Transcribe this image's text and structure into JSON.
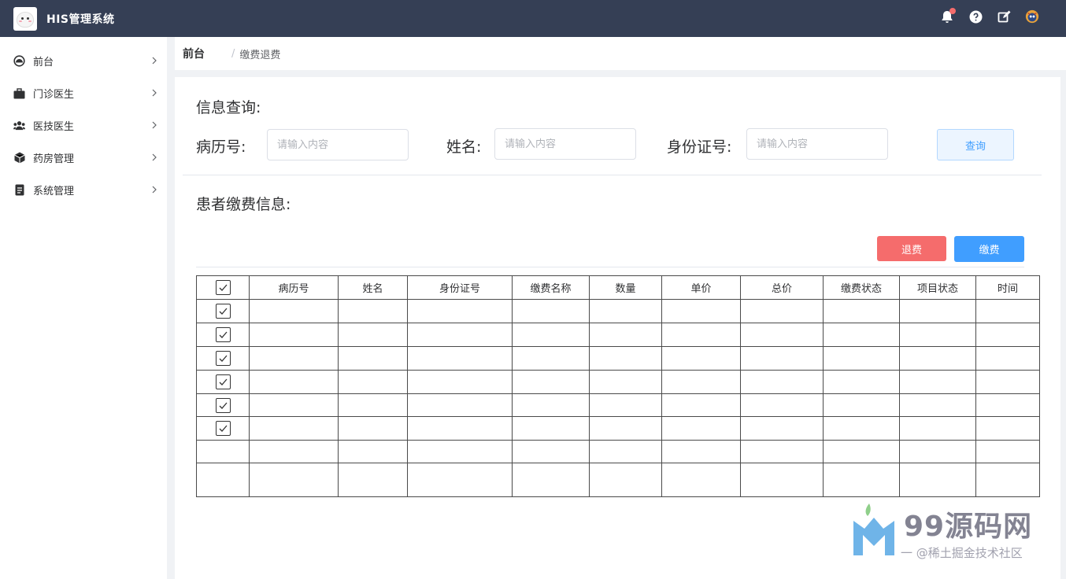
{
  "app": {
    "title": "HIS管理系统"
  },
  "header": {
    "icons": [
      "bell-icon",
      "help-icon",
      "edit-icon",
      "avatar"
    ],
    "badge_color": "#f56c6c"
  },
  "sidebar": {
    "items": [
      {
        "label": "前台",
        "icon": "dashboard-icon"
      },
      {
        "label": "门诊医生",
        "icon": "briefcase-icon"
      },
      {
        "label": "医技医生",
        "icon": "users-icon"
      },
      {
        "label": "药房管理",
        "icon": "box-icon"
      },
      {
        "label": "系统管理",
        "icon": "document-icon"
      }
    ]
  },
  "breadcrumb": {
    "home": "前台",
    "separator": "/",
    "current": "缴费退费"
  },
  "query": {
    "title": "信息查询:",
    "record_label": "病历号:",
    "record_placeholder": "请输入内容",
    "name_label": "姓名:",
    "name_placeholder": "请输入内容",
    "id_label": "身份证号:",
    "id_placeholder": "请输入内容",
    "search_button": "查询"
  },
  "payment": {
    "title": "患者缴费信息:",
    "refund_button": "退费",
    "pay_button": "缴费"
  },
  "table": {
    "columns": [
      "病历号",
      "姓名",
      "身份证号",
      "缴费名称",
      "数量",
      "单价",
      "总价",
      "缴费状态",
      "项目状态",
      "时间"
    ],
    "header_checked": true,
    "rows_checked": [
      true,
      true,
      true,
      true,
      true,
      true,
      false,
      false
    ]
  },
  "watermark": {
    "text": "99源码网",
    "subtext": "一 @稀土掘金技术社区"
  },
  "colors": {
    "header_bg": "#353f55",
    "primary": "#409eff",
    "danger": "#f56c6c"
  }
}
